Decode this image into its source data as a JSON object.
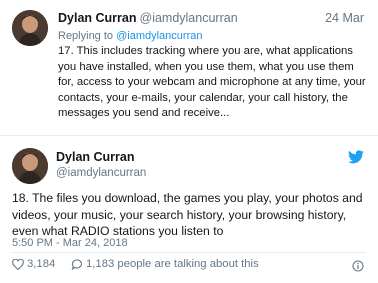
{
  "reply_tweet": {
    "name": "Dylan Curran",
    "handle": "@iamdylancurran",
    "date": "24 Mar",
    "replying_prefix": "Replying to",
    "replying_handle": "@iamdylancurran",
    "text": "17. This includes tracking where you are, what applications you have installed, when you use them, what you use them for, access to your webcam and microphone at any time, your contacts, your e-mails, your calendar, your call history, the messages you send and receive..."
  },
  "main_tweet": {
    "name": "Dylan Curran",
    "handle": "@iamdylancurran",
    "text": "18. The files you download, the games you play, your photos and videos, your music, your search history, your browsing history, even what RADIO stations you listen to",
    "timestamp": "5:50 PM - Mar 24, 2018",
    "likes": "3,184",
    "talking": "1,183 people are talking about this"
  },
  "colors": {
    "twitter_blue": "#1da1f2",
    "link_blue": "#1b95e0",
    "secondary_text": "#657786",
    "divider": "#e6ecf0"
  },
  "icons": [
    "twitter-bird-icon",
    "heart-icon",
    "speech-bubble-icon",
    "info-icon"
  ]
}
